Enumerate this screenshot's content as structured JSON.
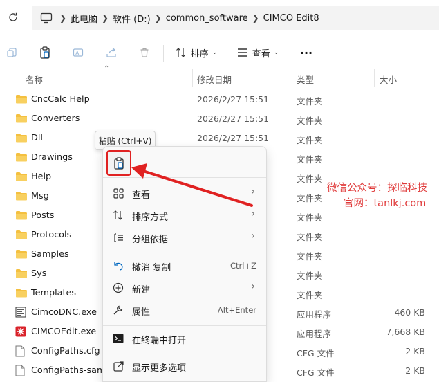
{
  "address": {
    "crumbs": [
      "此电脑",
      "软件 (D:)",
      "common_software",
      "CIMCO Edit8"
    ]
  },
  "toolbar": {
    "sort_label": "排序",
    "view_label": "查看",
    "more_label": "···"
  },
  "header": {
    "name": "名称",
    "date": "修改日期",
    "type": "类型",
    "size": "大小"
  },
  "files": [
    {
      "name": "CncCalc Help",
      "date": "2026/2/27 15:51",
      "type": "文件夹",
      "size": "",
      "icon": "folder-icon"
    },
    {
      "name": "Converters",
      "date": "2026/2/27 15:51",
      "type": "文件夹",
      "size": "",
      "icon": "folder-icon"
    },
    {
      "name": "Dll",
      "date": "2026/2/27 15:51",
      "type": "文件夹",
      "size": "",
      "icon": "folder-icon"
    },
    {
      "name": "Drawings",
      "date": "",
      "type": "文件夹",
      "size": "",
      "icon": "folder-icon"
    },
    {
      "name": "Help",
      "date": "",
      "type": "文件夹",
      "size": "",
      "icon": "folder-icon"
    },
    {
      "name": "Msg",
      "date": "",
      "type": "文件夹",
      "size": "",
      "icon": "folder-icon"
    },
    {
      "name": "Posts",
      "date": "",
      "type": "文件夹",
      "size": "",
      "icon": "folder-icon"
    },
    {
      "name": "Protocols",
      "date": "",
      "type": "文件夹",
      "size": "",
      "icon": "folder-icon"
    },
    {
      "name": "Samples",
      "date": "",
      "type": "文件夹",
      "size": "",
      "icon": "folder-icon"
    },
    {
      "name": "Sys",
      "date": "",
      "type": "文件夹",
      "size": "",
      "icon": "folder-icon"
    },
    {
      "name": "Templates",
      "date": "",
      "type": "文件夹",
      "size": "",
      "icon": "folder-icon"
    },
    {
      "name": "CimcoDNC.exe",
      "date": "",
      "type": "应用程序",
      "size": "460 KB",
      "icon": "dnc-app-icon"
    },
    {
      "name": "CIMCOEdit.exe",
      "date": "",
      "type": "应用程序",
      "size": "7,668 KB",
      "icon": "cimco-app-icon"
    },
    {
      "name": "ConfigPaths.cfg",
      "date": "",
      "type": "CFG 文件",
      "size": "2 KB",
      "icon": "file-icon"
    },
    {
      "name": "ConfigPaths-samp",
      "date": "",
      "type": "CFG 文件",
      "size": "2 KB",
      "icon": "file-icon"
    }
  ],
  "tooltip": "粘贴 (Ctrl+V)",
  "context_menu": {
    "view": "查看",
    "sort": "排序方式",
    "group": "分组依据",
    "undo": "撤消 复制",
    "undo_shortcut": "Ctrl+Z",
    "new": "新建",
    "properties": "属性",
    "properties_shortcut": "Alt+Enter",
    "terminal": "在终端中打开",
    "more": "显示更多选项"
  },
  "watermark": {
    "line1": "微信公众号：探临科技",
    "line2": "官网：tanlkj.com"
  },
  "colors": {
    "folder": "#f4c040",
    "highlight": "#e02222",
    "accent": "#0067c0"
  }
}
